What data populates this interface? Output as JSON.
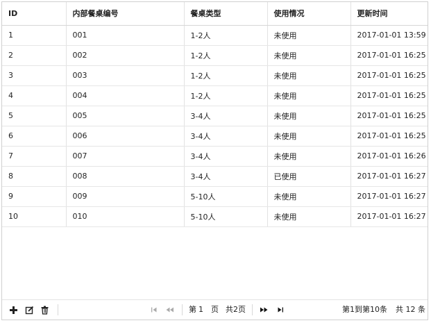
{
  "table": {
    "columns": [
      "ID",
      "内部餐桌编号",
      "餐桌类型",
      "使用情况",
      "更新时间"
    ],
    "rows": [
      [
        "1",
        "001",
        "1-2人",
        "未使用",
        "2017-01-01 13:59"
      ],
      [
        "2",
        "002",
        "1-2人",
        "未使用",
        "2017-01-01 16:25"
      ],
      [
        "3",
        "003",
        "1-2人",
        "未使用",
        "2017-01-01 16:25"
      ],
      [
        "4",
        "004",
        "1-2人",
        "未使用",
        "2017-01-01 16:25"
      ],
      [
        "5",
        "005",
        "3-4人",
        "未使用",
        "2017-01-01 16:25"
      ],
      [
        "6",
        "006",
        "3-4人",
        "未使用",
        "2017-01-01 16:25"
      ],
      [
        "7",
        "007",
        "3-4人",
        "未使用",
        "2017-01-01 16:26"
      ],
      [
        "8",
        "008",
        "3-4人",
        "已使用",
        "2017-01-01 16:27"
      ],
      [
        "9",
        "009",
        "5-10人",
        "未使用",
        "2017-01-01 16:27"
      ],
      [
        "10",
        "010",
        "5-10人",
        "未使用",
        "2017-01-01 16:27"
      ]
    ]
  },
  "toolbar": {
    "add_icon": "plus-icon",
    "edit_icon": "edit-icon",
    "delete_icon": "trash-icon"
  },
  "pagination": {
    "first_icon": "first-page-icon",
    "prev_icon": "prev-page-icon",
    "page_prefix": "第",
    "page_value": "1",
    "page_suffix": "页",
    "total_pages": "共2页",
    "next_icon": "next-page-icon",
    "last_icon": "last-page-icon",
    "range_text": "第1到第10条",
    "total_text": "共 12 条"
  }
}
